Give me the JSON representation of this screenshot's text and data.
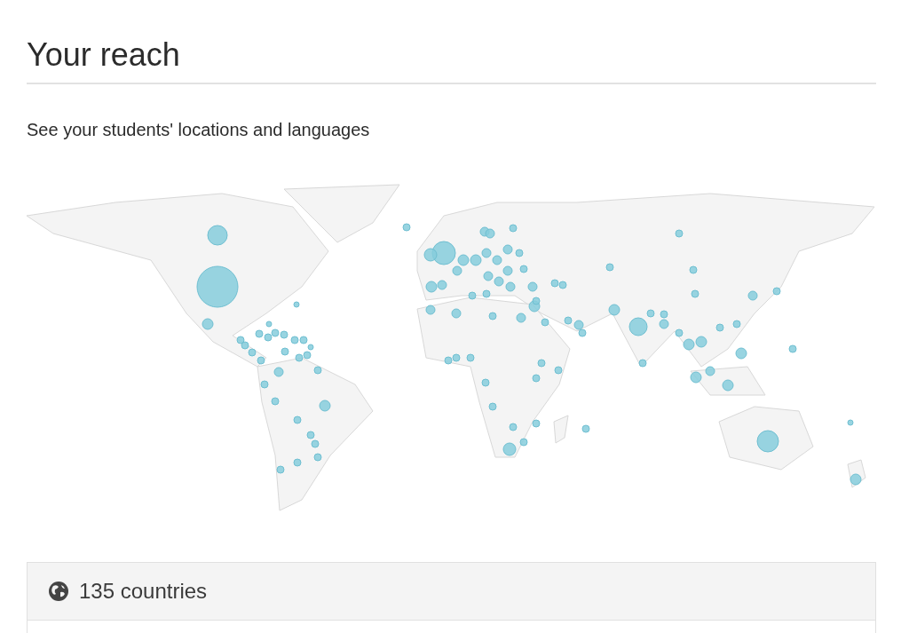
{
  "title": "Your reach",
  "subtitle": "See your students' locations and languages",
  "summary": {
    "label": "135 countries"
  }
}
